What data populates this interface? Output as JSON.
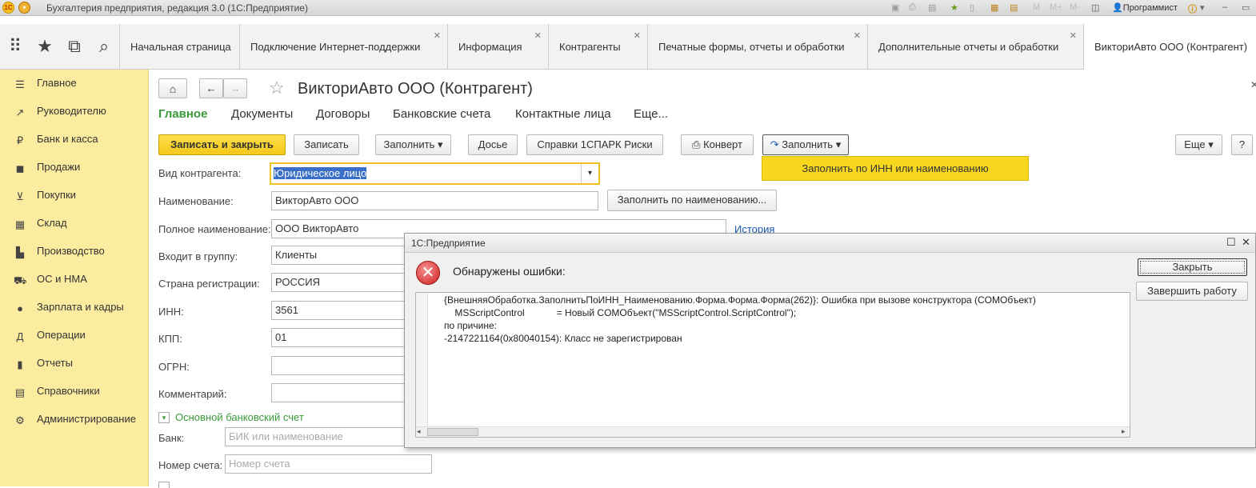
{
  "window": {
    "title": "Бухгалтерия предприятия, редакция 3.0  (1С:Предприятие)",
    "user": "Программист",
    "toolbar_icons": [
      "M",
      "M+",
      "M-"
    ]
  },
  "tabs": [
    {
      "label": "Начальная страница",
      "closable": false
    },
    {
      "label": "Подключение Интернет-поддержки",
      "closable": true
    },
    {
      "label": "Информация",
      "closable": true
    },
    {
      "label": "Контрагенты",
      "closable": true
    },
    {
      "label": "Печатные формы, отчеты и обработки",
      "closable": true
    },
    {
      "label": "Дополнительные отчеты и обработки",
      "closable": true
    },
    {
      "label": "ВикториАвто ООО (Контрагент)",
      "closable": false
    }
  ],
  "sidebar": {
    "items": [
      {
        "label": "Главное",
        "icon": "menu-icon"
      },
      {
        "label": "Руководителю",
        "icon": "chart-line-icon"
      },
      {
        "label": "Банк и касса",
        "icon": "ruble-icon"
      },
      {
        "label": "Продажи",
        "icon": "bag-icon"
      },
      {
        "label": "Покупки",
        "icon": "cart-icon"
      },
      {
        "label": "Склад",
        "icon": "warehouse-icon"
      },
      {
        "label": "Производство",
        "icon": "factory-icon"
      },
      {
        "label": "ОС и НМА",
        "icon": "truck-icon"
      },
      {
        "label": "Зарплата и кадры",
        "icon": "person-icon"
      },
      {
        "label": "Операции",
        "icon": "operations-icon"
      },
      {
        "label": "Отчеты",
        "icon": "bar-chart-icon"
      },
      {
        "label": "Справочники",
        "icon": "book-icon"
      },
      {
        "label": "Администрирование",
        "icon": "gear-icon"
      }
    ]
  },
  "form": {
    "title": "ВикториАвто ООО (Контрагент)",
    "nav": [
      "Главное",
      "Документы",
      "Договоры",
      "Банковские счета",
      "Контактные лица",
      "Еще..."
    ],
    "buttons": {
      "save_close": "Записать и закрыть",
      "save": "Записать",
      "fill": "Заполнить",
      "dossier": "Досье",
      "spark": "Справки 1СПАРК Риски",
      "envelope": "Конверт",
      "fill2": "Заполнить",
      "more": "Еще",
      "help": "?",
      "fill_by_name": "Заполнить по наименованию..."
    },
    "dropdown_item": "Заполнить по ИНН или наименованию",
    "fields": {
      "type_label": "Вид контрагента:",
      "type_value": "Юридическое лицо",
      "name_label": "Наименование:",
      "name_value": "ВикторАвто ООО",
      "full_label": "Полное наименование:",
      "full_value": "ООО ВикторАвто",
      "history": "История",
      "group_label": "Входит в группу:",
      "group_value": "Клиенты",
      "country_label": "Страна регистрации:",
      "country_value": "РОССИЯ",
      "inn_label": "ИНН:",
      "inn_value": "3561",
      "kpp_label": "КПП:",
      "kpp_value": "01",
      "ogrn_label": "ОГРН:",
      "comment_label": "Комментарий:",
      "bank_section": "Основной банковский счет",
      "bank_label": "Банк:",
      "bank_placeholder": "БИК или наименование",
      "account_label": "Номер счета:",
      "account_placeholder": "Номер счета"
    }
  },
  "dialog": {
    "title": "1С:Предприятие",
    "heading": "Обнаружены ошибки:",
    "message_lines": [
      "{ВнешняяОбработка.ЗаполнитьПоИНН_Наименованию.Форма.Форма.Форма(262)}: Ошибка при вызове конструктора (COMОбъект)",
      "    MSScriptControl            = Новый COMОбъект(\"MSScriptControl.ScriptControl\");",
      "по причине:",
      "-2147221164(0x80040154): Класс не зарегистрирован"
    ],
    "close_button": "Закрыть",
    "exit_button": "Завершить работу"
  },
  "colors": {
    "accent_yellow": "#f5c81a",
    "sidebar": "#fbeca0",
    "nav_active": "#3a9a3a",
    "link": "#1a5bab"
  }
}
